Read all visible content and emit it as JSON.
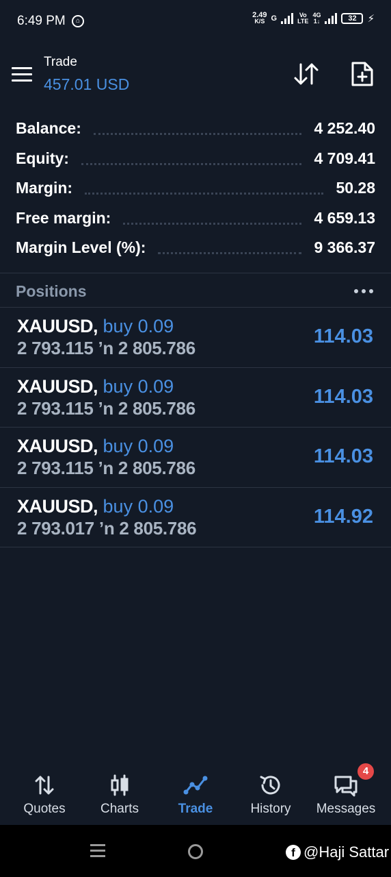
{
  "status_bar": {
    "time": "6:49 PM",
    "speed_value": "2.49",
    "speed_unit": "K/S",
    "network1": "G",
    "network2_top": "Vo",
    "network2_bottom": "LTE",
    "network3_top": "4G",
    "network3_bottom": "1↓",
    "battery": "32"
  },
  "header": {
    "title": "Trade",
    "subtitle": "457.01 USD",
    "menu_icon": "hamburger-menu-icon",
    "sort_icon": "sort-arrows-icon",
    "new_order_icon": "new-document-icon"
  },
  "summary": [
    {
      "label": "Balance:",
      "value": "4 252.40"
    },
    {
      "label": "Equity:",
      "value": "4 709.41"
    },
    {
      "label": "Margin:",
      "value": "50.28"
    },
    {
      "label": "Free margin:",
      "value": "4 659.13"
    },
    {
      "label": "Margin Level (%):",
      "value": "9 366.37"
    }
  ],
  "positions_section": {
    "title": "Positions"
  },
  "positions": [
    {
      "symbol": "XAUUSD,",
      "side": "buy 0.09",
      "prices": "2 793.115 ’n  2 805.786",
      "profit": "114.03"
    },
    {
      "symbol": "XAUUSD,",
      "side": "buy 0.09",
      "prices": "2 793.115 ’n  2 805.786",
      "profit": "114.03"
    },
    {
      "symbol": "XAUUSD,",
      "side": "buy 0.09",
      "prices": "2 793.115 ’n  2 805.786",
      "profit": "114.03"
    },
    {
      "symbol": "XAUUSD,",
      "side": "buy 0.09",
      "prices": "2 793.017 ’n  2 805.786",
      "profit": "114.92"
    }
  ],
  "bottom_nav": [
    {
      "label": "Quotes",
      "icon": "quotes-icon"
    },
    {
      "label": "Charts",
      "icon": "charts-icon"
    },
    {
      "label": "Trade",
      "icon": "trade-icon",
      "active": true
    },
    {
      "label": "History",
      "icon": "history-icon"
    },
    {
      "label": "Messages",
      "icon": "messages-icon",
      "badge": "4"
    }
  ],
  "watermark": "@Haji Sattar",
  "colors": {
    "background": "#131a26",
    "accent": "#4a90e2",
    "muted": "#a9b4c2",
    "badge": "#e44848"
  }
}
